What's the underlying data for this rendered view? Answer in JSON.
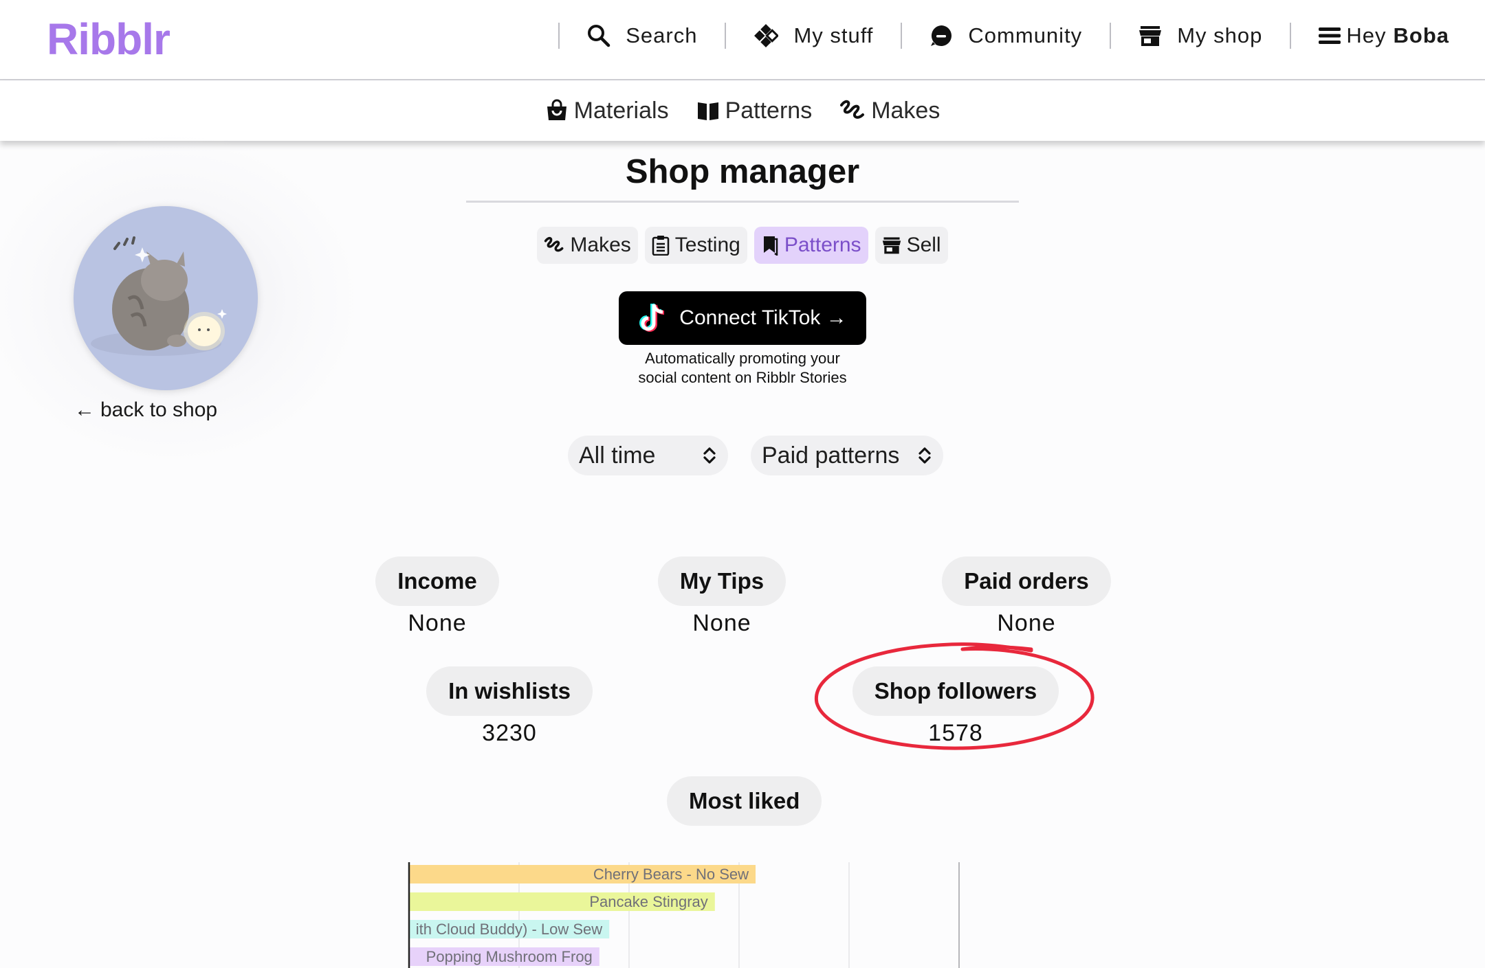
{
  "header": {
    "logo": "Ribblr",
    "nav": [
      {
        "label": "Search",
        "icon": "search-icon"
      },
      {
        "label": "My stuff",
        "icon": "diamond-grid-icon"
      },
      {
        "label": "Community",
        "icon": "chat-bubble-icon"
      },
      {
        "label": "My shop",
        "icon": "storefront-icon"
      }
    ],
    "greeting": "Hey",
    "user_name": "Boba",
    "menu_icon": "hamburger-menu-icon"
  },
  "subnav": [
    {
      "label": "Materials",
      "icon": "shopping-bag-icon"
    },
    {
      "label": "Patterns",
      "icon": "open-book-icon"
    },
    {
      "label": "Makes",
      "icon": "yarn-stitch-icon"
    }
  ],
  "profile": {
    "avatar": "cat-illustration-avatar",
    "back_label": "back to shop"
  },
  "page": {
    "title": "Shop manager",
    "tabs": [
      {
        "label": "Makes",
        "icon": "yarn-stitch-icon",
        "active": false
      },
      {
        "label": "Testing",
        "icon": "clipboard-icon",
        "active": false
      },
      {
        "label": "Patterns",
        "icon": "bookmark-icon",
        "active": true
      },
      {
        "label": "Sell",
        "icon": "storefront-icon",
        "active": false
      }
    ],
    "tiktok": {
      "button_label": "Connect TikTok →",
      "note_line1": "Automatically promoting your",
      "note_line2": "social content on Ribblr Stories"
    },
    "filters": {
      "period": "All time",
      "pattern_type": "Paid patterns"
    },
    "stats": {
      "income": {
        "label": "Income",
        "value": "None"
      },
      "tips": {
        "label": "My Tips",
        "value": "None"
      },
      "paid_orders": {
        "label": "Paid orders",
        "value": "None"
      },
      "wishlists": {
        "label": "In wishlists",
        "value": "3230"
      },
      "followers": {
        "label": "Shop followers",
        "value": "1578"
      }
    },
    "most_liked_label": "Most liked"
  },
  "colors": {
    "brand": "#a778ea",
    "active_tab_bg": "#e3d2fb",
    "annotation": "#e8283c"
  },
  "chart_data": {
    "type": "bar",
    "orientation": "horizontal",
    "title": "Most liked",
    "categories": [
      "Cherry Bears - No Sew",
      "Pancake Stingray",
      "ith Cloud Buddy) - Low Sew",
      "Popping Mushroom Frog"
    ],
    "values": [
      315,
      278,
      182,
      173
    ],
    "colors": [
      "#fcd98a",
      "#eaf69a",
      "#c9f6f0",
      "#e7d2fa"
    ],
    "xlim": [
      0,
      500
    ],
    "grid": true
  }
}
